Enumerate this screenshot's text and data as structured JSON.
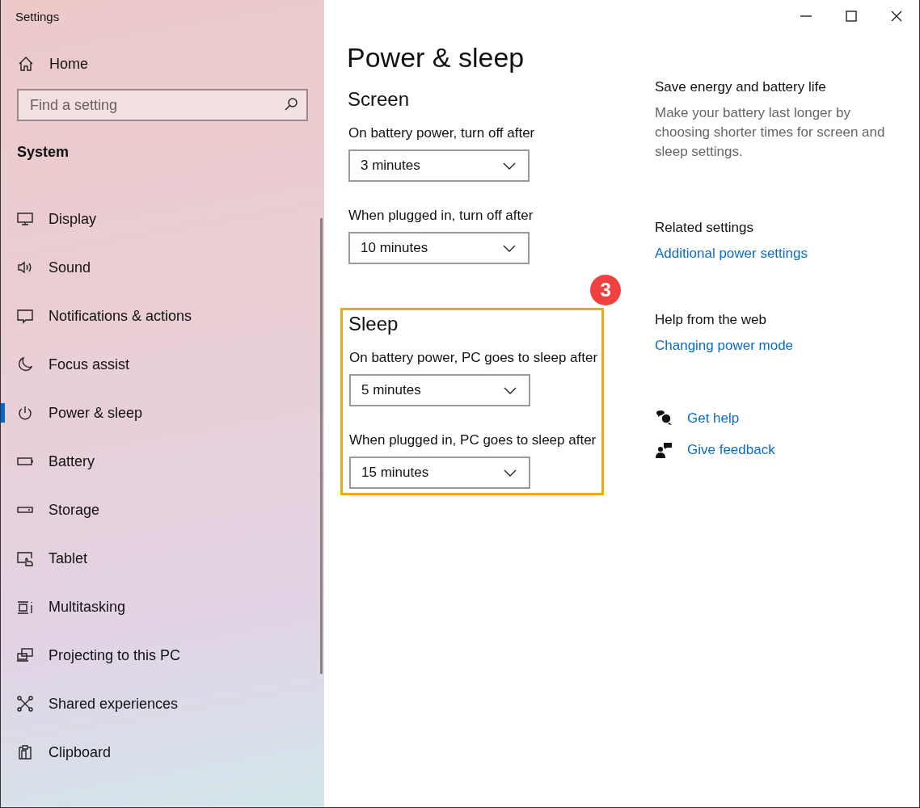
{
  "window": {
    "title": "Settings"
  },
  "sidebar": {
    "home": "Home",
    "search": {
      "placeholder": "Find a setting"
    },
    "section": "System",
    "items": [
      {
        "label": "Display",
        "selected": false
      },
      {
        "label": "Sound",
        "selected": false
      },
      {
        "label": "Notifications & actions",
        "selected": false
      },
      {
        "label": "Focus assist",
        "selected": false
      },
      {
        "label": "Power & sleep",
        "selected": true
      },
      {
        "label": "Battery",
        "selected": false
      },
      {
        "label": "Storage",
        "selected": false
      },
      {
        "label": "Tablet",
        "selected": false
      },
      {
        "label": "Multitasking",
        "selected": false
      },
      {
        "label": "Projecting to this PC",
        "selected": false
      },
      {
        "label": "Shared experiences",
        "selected": false
      },
      {
        "label": "Clipboard",
        "selected": false
      }
    ]
  },
  "page": {
    "title": "Power & sleep",
    "sections": [
      {
        "heading": "Screen",
        "highlighted": false,
        "settings": [
          {
            "label": "On battery power, turn off after",
            "value": "3 minutes"
          },
          {
            "label": "When plugged in, turn off after",
            "value": "10 minutes"
          }
        ]
      },
      {
        "heading": "Sleep",
        "highlighted": true,
        "badge": "3",
        "settings": [
          {
            "label": "On battery power, PC goes to sleep after",
            "value": "5 minutes"
          },
          {
            "label": "When plugged in, PC goes to sleep after",
            "value": "15 minutes"
          }
        ]
      }
    ]
  },
  "aside": {
    "tip": {
      "heading": "Save energy and battery life",
      "text": "Make your battery last longer by choosing shorter times for screen and sleep settings."
    },
    "related": {
      "heading": "Related settings",
      "links": [
        "Additional power settings"
      ]
    },
    "web": {
      "heading": "Help from the web",
      "links": [
        "Changing power mode"
      ]
    },
    "actions": [
      "Get help",
      "Give feedback"
    ]
  }
}
